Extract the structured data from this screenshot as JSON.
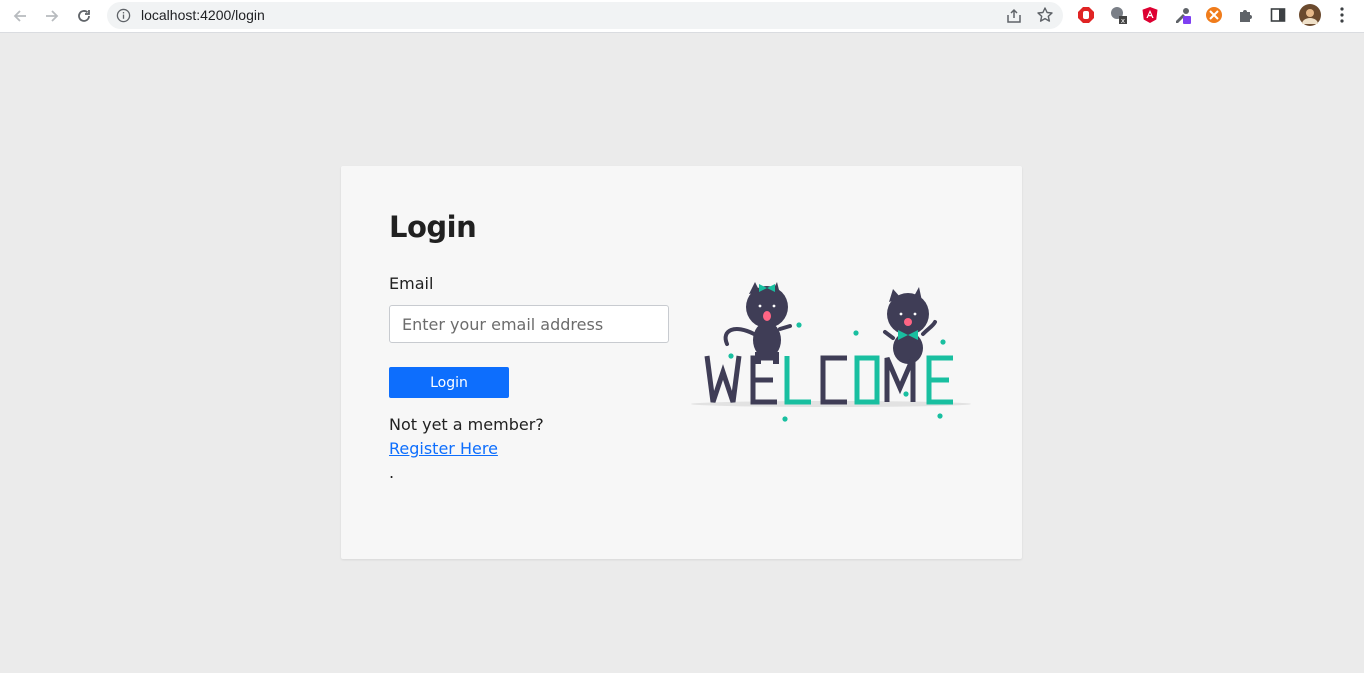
{
  "browser": {
    "url": "localhost:4200/login",
    "icons": {
      "back": "arrow-left-icon",
      "forward": "arrow-right-icon",
      "reload": "reload-icon",
      "site_info": "info-icon",
      "share": "share-icon",
      "bookmark": "star-icon",
      "extensions": "puzzle-icon",
      "side_panel": "side-panel-icon",
      "profile": "avatar",
      "menu": "kebab-menu-icon"
    }
  },
  "login": {
    "title": "Login",
    "email_label": "Email",
    "email_placeholder": "Enter your email address",
    "email_value": "",
    "submit_label": "Login",
    "member_prompt": "Not yet a member?",
    "register_link": "Register Here",
    "trailing_dot": "."
  },
  "illustration": {
    "text": "WELCOME",
    "colors": {
      "dark": "#3f3d56",
      "accent": "#19bfa0"
    }
  },
  "colors": {
    "page_bg": "#ebebeb",
    "card_bg": "#f7f7f7",
    "primary": "#0d6efd"
  }
}
